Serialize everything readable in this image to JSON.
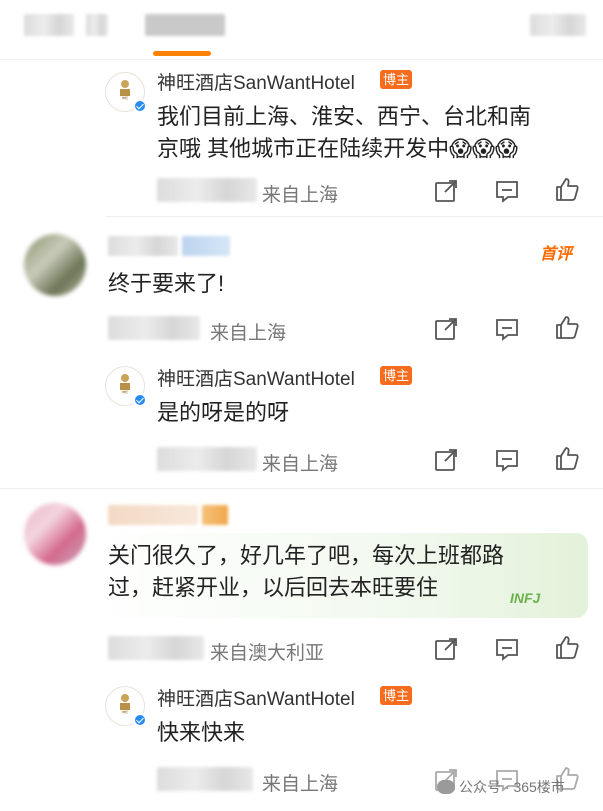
{
  "hotel": {
    "name": "神旺酒店SanWantHotel",
    "badge": "博主"
  },
  "comments": [
    {
      "reply_text_lines": [
        "我们目前上海、淮安、西宁、台北和南",
        "京哦 其他城市正在陆续开发中😱😱😱"
      ],
      "location": "来自上海"
    },
    {
      "first_badge": "首评",
      "text": "终于要来了!",
      "location": "来自上海",
      "reply_text": "是的呀是的呀",
      "reply_location": "来自上海"
    },
    {
      "text_lines": [
        "关门很久了，好几年了吧，每次上班都路",
        "过，赶紧开业，以后回去本旺要住"
      ],
      "sticker": "INFJ",
      "location": "来自澳大利亚",
      "reply_text": "快来快来",
      "reply_location": "来自上海"
    }
  ],
  "watermark": "公众号 · 365楼市",
  "colors": {
    "accent": "#ff8200",
    "bozhu_badge": "#f56c1d",
    "verified": "#2b8cf0",
    "first_comment": "#ff6a00"
  },
  "icons": {
    "share": "share-icon",
    "comment": "comment-icon",
    "like": "like-icon"
  }
}
